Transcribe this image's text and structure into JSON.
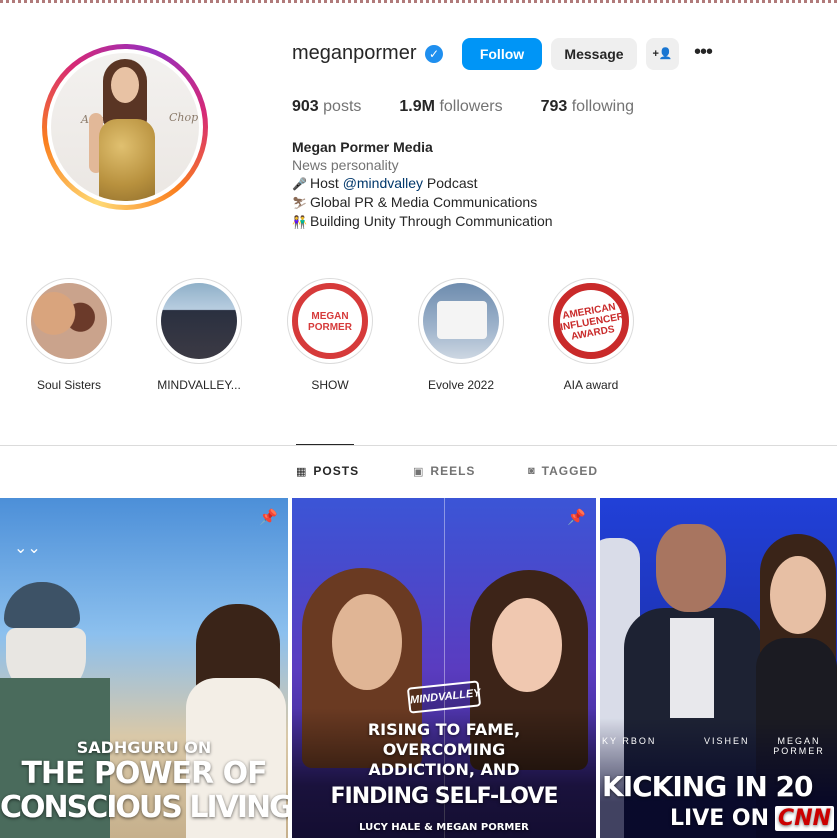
{
  "profile": {
    "username": "meganpormer",
    "verified_icon": "verified-badge-icon",
    "follow_label": "Follow",
    "message_label": "Message",
    "suggest_label": "+👤",
    "more_label": "•••",
    "stats": {
      "posts_count": "903",
      "posts_label": "posts",
      "followers_count": "1.9M",
      "followers_label": "followers",
      "following_count": "793",
      "following_label": "following"
    },
    "bio": {
      "name": "Megan Pormer Media",
      "category": "News personality",
      "line1_prefix": "Host ",
      "line1_mention": "@mindvalley",
      "line1_suffix": " Podcast",
      "line2": "Global PR & Media Communications",
      "line3": "Building Unity Through Communication"
    },
    "avatar_text_left": "Ame",
    "avatar_text_right": "Chop"
  },
  "highlights": [
    {
      "label": "Soul Sisters"
    },
    {
      "label": "MINDVALLEY..."
    },
    {
      "label": "SHOW",
      "logo_text": "MEGAN PORMER"
    },
    {
      "label": "Evolve 2022"
    },
    {
      "label": "AIA award",
      "logo_text": "AMERICAN INFLUENCER AWARDS"
    }
  ],
  "tabs": [
    {
      "label": "POSTS",
      "icon": "grid-icon",
      "active": true
    },
    {
      "label": "REELS",
      "icon": "reels-icon",
      "active": false
    },
    {
      "label": "TAGGED",
      "icon": "tagged-icon",
      "active": false
    }
  ],
  "posts": [
    {
      "pinned": true,
      "line1": "SADHGURU ON",
      "line2": "THE POWER OF",
      "line3": "CONSCIOUS LIVING"
    },
    {
      "pinned": true,
      "badge": "MINDVALLEY",
      "line1": "RISING TO FAME,",
      "line2": "OVERCOMING",
      "line3": "ADDICTION, AND",
      "line4": "FINDING SELF-LOVE",
      "line5": "LUCY HALE & MEGAN PORMER"
    },
    {
      "pinned": false,
      "names_left": "KY RBON",
      "names_mid": "VISHEN",
      "names_right": "MEGAN PORMER",
      "line1": "KICKING IN 20",
      "line2": "LIVE ON",
      "network": "CNN"
    }
  ],
  "colors": {
    "follow_button": "#0095f6",
    "secondary_button": "#efefef",
    "muted_text": "#737373",
    "mention": "#00376b"
  }
}
